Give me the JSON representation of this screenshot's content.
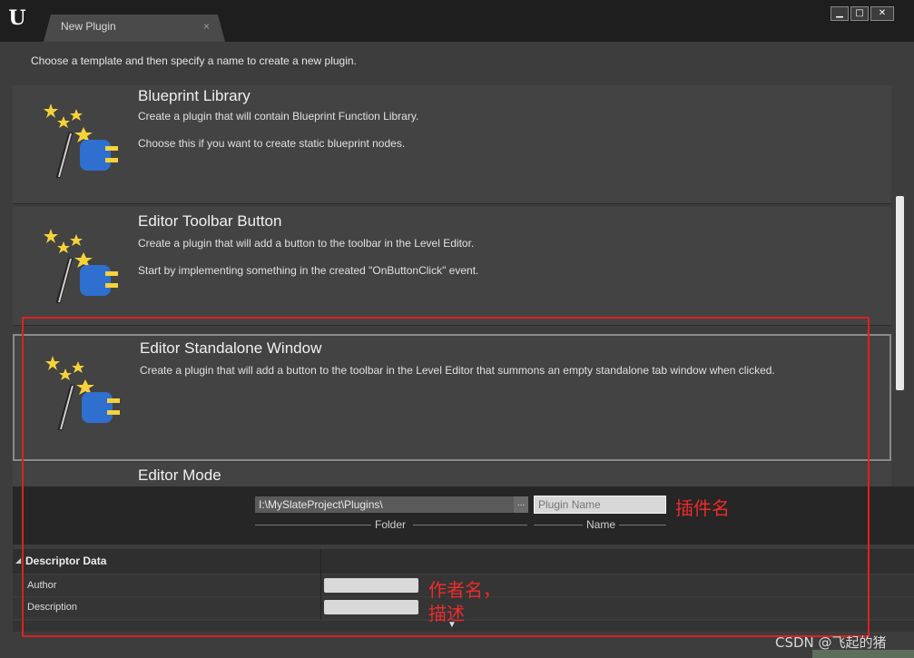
{
  "window": {
    "tab_title": "New Plugin",
    "tab_close": "×",
    "buttons": {
      "minimize": "▁",
      "maximize": "□",
      "close": "✕"
    }
  },
  "instructions": "Choose a template and then specify a name to create a new plugin.",
  "templates": [
    {
      "title": "Blueprint Library",
      "line1": "Create a plugin that will contain Blueprint Function Library.",
      "line2": "Choose this if you want to create static blueprint nodes."
    },
    {
      "title": "Editor Toolbar Button",
      "line1": "Create a plugin that will add a button to the toolbar in the Level Editor.",
      "line2": "Start by implementing something in the created \"OnButtonClick\" event."
    },
    {
      "title": "Editor Standalone Window",
      "line1": "Create a plugin that will add a button to the toolbar in the Level Editor that summons an empty standalone tab window when clicked.",
      "line2": ""
    },
    {
      "title": "Editor Mode",
      "line1": "",
      "line2": ""
    }
  ],
  "plugin_form": {
    "folder_value": "I:\\MySlateProject\\Plugins\\",
    "browse_label": "...",
    "folder_label": "Folder",
    "name_placeholder": "Plugin Name",
    "name_label": "Name"
  },
  "descriptor": {
    "header": "Descriptor Data",
    "rows": [
      {
        "label": "Author"
      },
      {
        "label": "Description"
      }
    ]
  },
  "annotations": {
    "plugin_name": "插件名",
    "author": "作者名，",
    "description": "描述"
  },
  "watermark": "CSDN @飞起的猪",
  "colors": {
    "annotation_red": "#e02020"
  }
}
